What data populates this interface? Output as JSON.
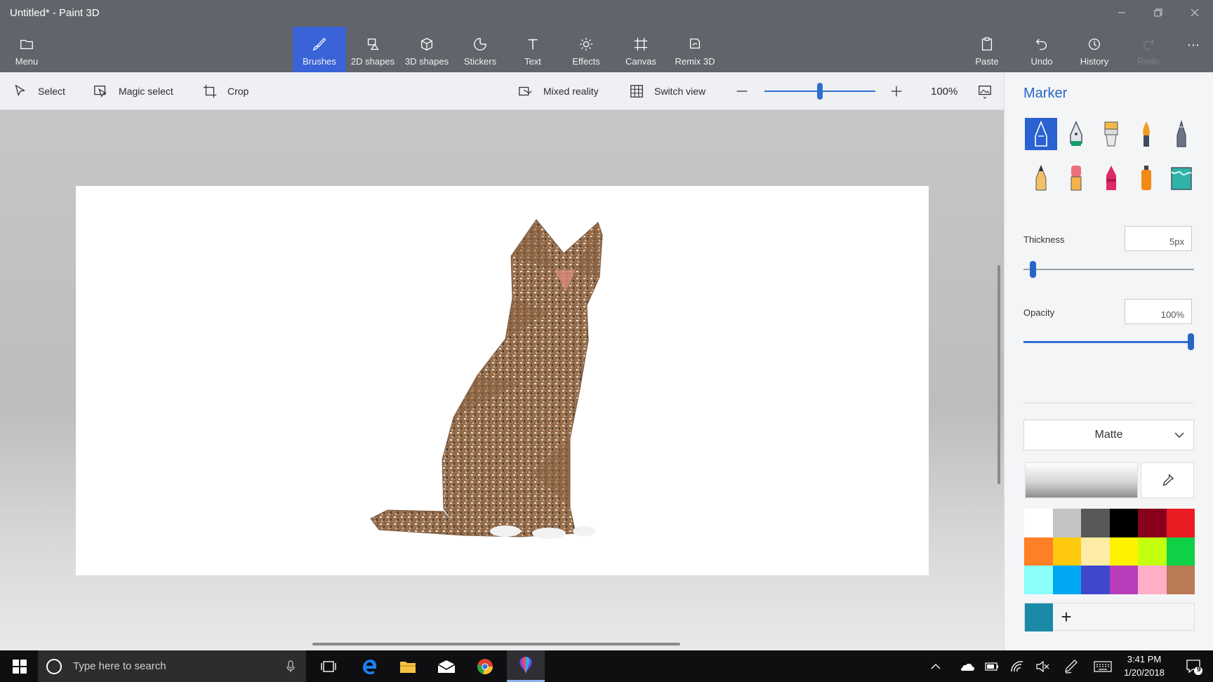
{
  "window": {
    "title": "Untitled* - Paint 3D"
  },
  "ribbon": {
    "menu_label": "Menu",
    "tools": [
      "Brushes",
      "2D shapes",
      "3D shapes",
      "Stickers",
      "Text",
      "Effects",
      "Canvas",
      "Remix 3D"
    ],
    "active_tool": "Brushes",
    "paste_label": "Paste",
    "undo_label": "Undo",
    "history_label": "History",
    "redo_label": "Redo"
  },
  "subtoolbar": {
    "select_label": "Select",
    "magic_select_label": "Magic select",
    "crop_label": "Crop",
    "mixed_reality_label": "Mixed reality",
    "switch_view_label": "Switch view",
    "zoom_value": "100%",
    "zoom_level_fraction": 0.5
  },
  "panel": {
    "title": "Marker",
    "brush_names": [
      "marker",
      "calligraphy-pen",
      "oil-brush",
      "watercolor",
      "pixel-pen",
      "pencil",
      "eraser",
      "crayon",
      "spray-can",
      "fill"
    ],
    "selected_brush": "marker",
    "thickness_label": "Thickness",
    "thickness_value": "5px",
    "thickness_fraction": 0.04,
    "opacity_label": "Opacity",
    "opacity_value": "100%",
    "opacity_fraction": 1.0,
    "finish_value": "Matte",
    "palette": [
      "#ffffff",
      "#c3c3c3",
      "#585858",
      "#000000",
      "#88001b",
      "#ec1c24",
      "#ff7f27",
      "#ffc90e",
      "#fdeca6",
      "#fff200",
      "#c4ff0e",
      "#0ed145",
      "#8cfffb",
      "#00a8f3",
      "#3f48cc",
      "#b83dba",
      "#ffaec8",
      "#b97a56"
    ],
    "current_color": "#1a8aa8",
    "accent_color": "#2b62d1"
  },
  "taskbar": {
    "search_placeholder": "Type here to search",
    "time": "3:41 PM",
    "date": "1/20/2018",
    "notification_count": "9"
  }
}
